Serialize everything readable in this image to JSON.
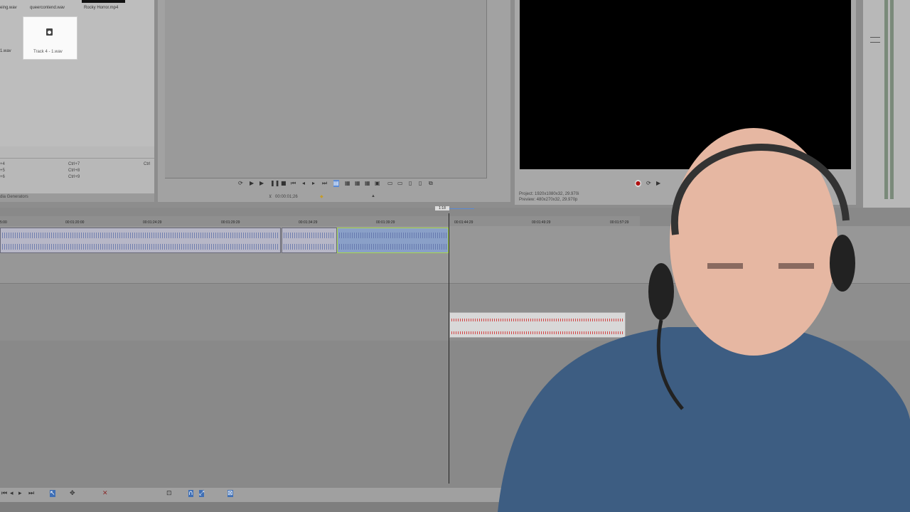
{
  "media": {
    "items": [
      {
        "label": "eing.wav"
      },
      {
        "label": "queercontend.wav"
      },
      {
        "label": "Rocky Horror.mp4"
      },
      {
        "label": "1.wav"
      },
      {
        "label": "Track 4 - 1.wav"
      }
    ]
  },
  "shortcuts": {
    "left": [
      "+4",
      "+5",
      "+6"
    ],
    "mid": [
      "Ctrl+7",
      "Ctrl+8",
      "Ctrl+9"
    ],
    "right": "Ctrl"
  },
  "generators_tab": "dia Generators",
  "trimmer": {
    "timecode": "00:00:01;26"
  },
  "preview": {
    "project": "Project:  1920x1080x32, 29.970i",
    "preview": "Preview:  480x270x32, 29.970p"
  },
  "timeline": {
    "cursor_time": "1:18",
    "ruler_labels": [
      "5:00",
      "00:01:20:00",
      "00:01:24:29",
      "00:01:29:29",
      "00:01:34:29",
      "00:01:39:29",
      "00:01:44:29",
      "00:01:49:29",
      "00:01:5?:29"
    ]
  },
  "icons": {
    "play": "play-icon",
    "pause": "pause-icon",
    "stop": "stop-icon",
    "loop": "loop-icon",
    "record": "record-icon",
    "snap": "magnet-icon"
  },
  "colors": {
    "accent": "#5b8bd6",
    "selection": "#a8d84a",
    "red_wave": "#d02020"
  }
}
